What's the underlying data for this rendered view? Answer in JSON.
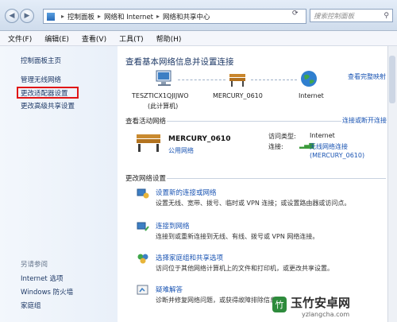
{
  "address": {
    "segments": [
      "控制面板",
      "网络和 Internet",
      "网络和共享中心"
    ],
    "search_placeholder": "搜索控制面板"
  },
  "menu": [
    "文件(F)",
    "编辑(E)",
    "查看(V)",
    "工具(T)",
    "帮助(H)"
  ],
  "sidebar": {
    "home": "控制面板主页",
    "items": [
      "管理无线网络",
      "更改适配器设置",
      "更改高级共享设置"
    ],
    "see_also_header": "另请参阅",
    "see_also": [
      "Internet 选项",
      "Windows 防火墙",
      "家庭组"
    ]
  },
  "main": {
    "title": "查看基本网络信息并设置连接",
    "full_map": "查看完整映射",
    "nodes": [
      {
        "name": "TESZTICX1QJIJWO",
        "sub": "(此计算机)"
      },
      {
        "name": "MERCURY_0610",
        "sub": ""
      },
      {
        "name": "Internet",
        "sub": ""
      }
    ],
    "active_header": "查看活动网络",
    "connect_link": "连接或断开连接",
    "network": {
      "name": "MERCURY_0610",
      "type": "公用网络",
      "access_label": "访问类型:",
      "access_value": "Internet",
      "conn_label": "连接:",
      "conn_value": "无线网络连接",
      "conn_sub": "(MERCURY_0610)"
    },
    "change_header": "更改网络设置",
    "tasks": [
      {
        "title": "设置新的连接或网络",
        "desc": "设置无线、宽带、拨号、临时或 VPN 连接；或设置路由器或访问点。"
      },
      {
        "title": "连接到网络",
        "desc": "连接到或重新连接到无线、有线、拨号或 VPN 网络连接。"
      },
      {
        "title": "选择家庭组和共享选项",
        "desc": "访问位于其他网络计算机上的文件和打印机，或更改共享设置。"
      },
      {
        "title": "疑难解答",
        "desc": "诊断并修复网络问题，或获得故障排除信息。"
      }
    ]
  },
  "watermark": {
    "brand": "玉竹安卓网",
    "url": "yzlangcha.com"
  }
}
